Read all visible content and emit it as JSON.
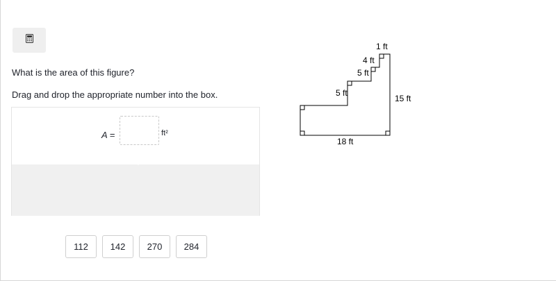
{
  "toolbar": {
    "calculator_icon": "calculator-icon"
  },
  "question": {
    "prompt": "What is the area of this figure?",
    "instruction": "Drag and drop the appropriate number into the box."
  },
  "equation": {
    "variable": "A",
    "equals": "=",
    "unit": "ft²"
  },
  "choices": [
    "112",
    "142",
    "270",
    "284"
  ],
  "figure": {
    "labels": {
      "top": "1 ft",
      "step_upper_vertical": "4 ft",
      "step_upper_horizontal": "5 ft",
      "step_lower_vertical": "5 ft",
      "right_side": "15 ft",
      "bottom": "18 ft"
    },
    "stroke_color": "#000000"
  }
}
